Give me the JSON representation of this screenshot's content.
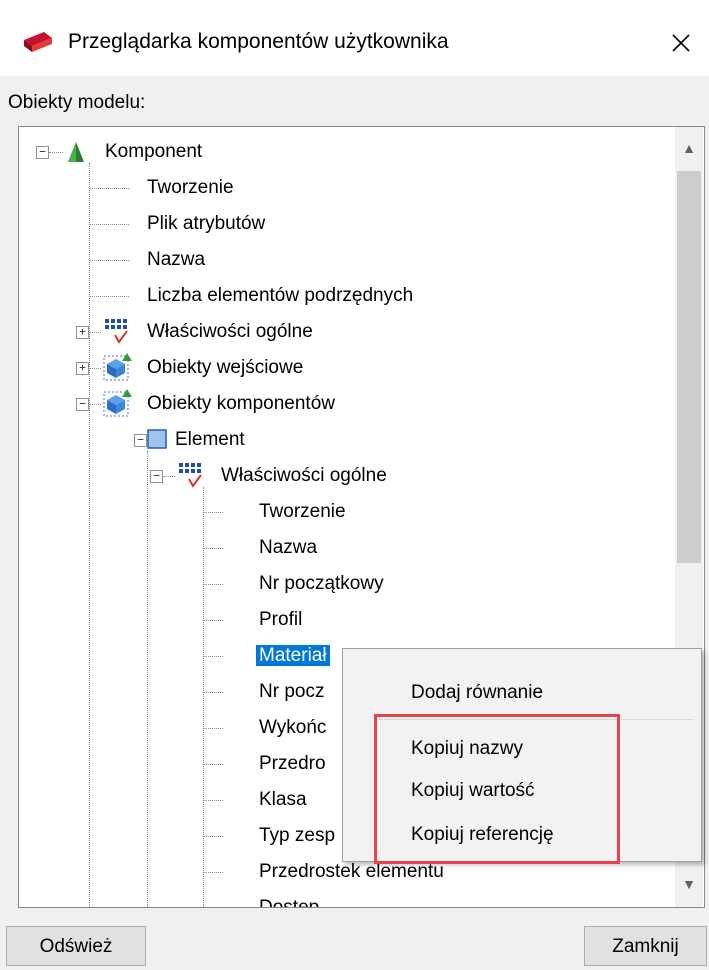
{
  "window": {
    "title": "Przeglądarka komponentów użytkownika",
    "model_objects_label": "Obiekty modelu:"
  },
  "tree": {
    "root": "Komponent",
    "root_children": [
      "Tworzenie",
      "Plik atrybutów",
      "Nazwa",
      "Liczba elementów podrzędnych"
    ],
    "general_props": "Właściwości ogólne",
    "input_objects": "Obiekty wejściowe",
    "component_objects": "Obiekty komponentów",
    "element": "Element",
    "element_general_props": "Właściwości ogólne",
    "element_props": [
      "Tworzenie",
      "Nazwa",
      "Nr początkowy",
      "Profil",
      "Materiał",
      "Nr pocz",
      "Wykońc",
      "Przedro",
      "Klasa",
      "Typ zesp",
      "Przedrostek elementu",
      "Dostęp"
    ],
    "selected_item": "Materiał"
  },
  "context_menu": {
    "items": [
      "Dodaj równanie",
      "Kopiuj nazwy",
      "Kopiuj wartość",
      "Kopiuj referencję"
    ]
  },
  "buttons": {
    "refresh": "Odśwież",
    "close": "Zamknij"
  },
  "colors": {
    "selection": "#0078d7",
    "highlight_box": "#e8434f",
    "root_icon": "#2e7d32"
  },
  "icons": [
    "app-icon",
    "close-icon",
    "component-icon",
    "attributes-icon",
    "objects-icon",
    "element-icon"
  ]
}
